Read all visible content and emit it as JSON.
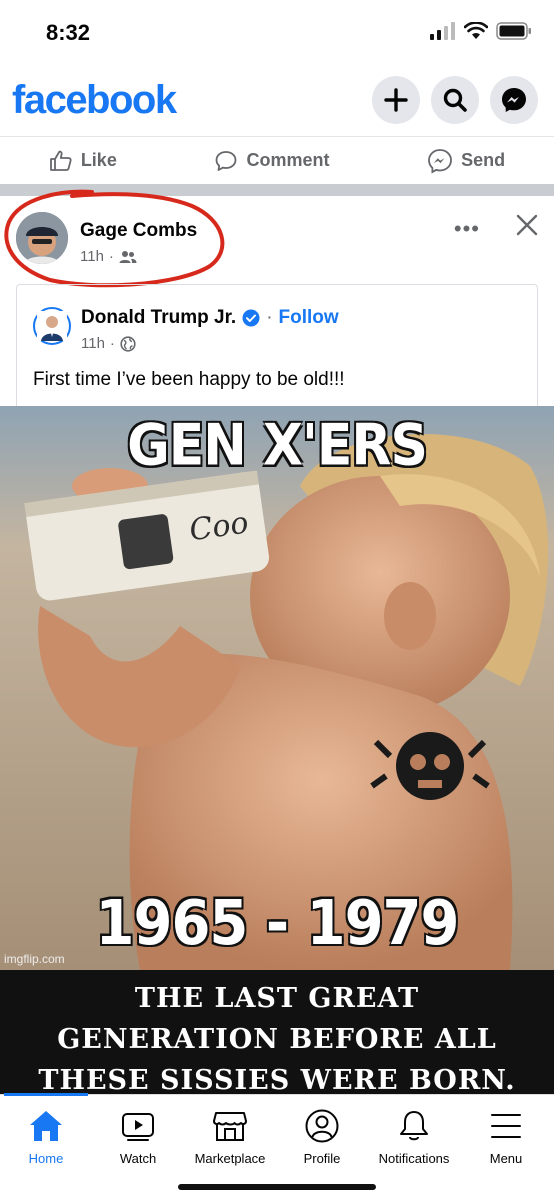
{
  "status_bar": {
    "time": "8:32"
  },
  "header": {
    "logo": "facebook",
    "buttons": [
      "plus-icon",
      "search-icon",
      "messenger-icon"
    ]
  },
  "actions": {
    "like": "Like",
    "comment": "Comment",
    "send": "Send"
  },
  "post": {
    "author": "Gage Combs",
    "time": "11h",
    "audience_icon": "friends-icon",
    "annotation_color": "#d6291c",
    "shared": {
      "page_name": "Donald Trump Jr.",
      "verified": true,
      "follow": "Follow",
      "time": "11h",
      "audience_icon": "globe-icon",
      "text": "First time I’ve been happy to be old!!!"
    }
  },
  "meme": {
    "top_text": "GEN X'ERS",
    "years": "1965 - 1979",
    "watermark": "imgflip.com",
    "caption_lines": [
      "THE LAST GREAT",
      "GENERATION BEFORE ALL",
      "THESE SISSIES WERE BORN."
    ]
  },
  "tabs": [
    {
      "label": "Home",
      "icon": "home-icon",
      "active": true
    },
    {
      "label": "Watch",
      "icon": "watch-icon"
    },
    {
      "label": "Marketplace",
      "icon": "marketplace-icon"
    },
    {
      "label": "Profile",
      "icon": "profile-icon"
    },
    {
      "label": "Notifications",
      "icon": "bell-icon"
    },
    {
      "label": "Menu",
      "icon": "menu-icon"
    }
  ],
  "colors": {
    "brand": "#1877f2",
    "secondary_text": "#65676b"
  }
}
